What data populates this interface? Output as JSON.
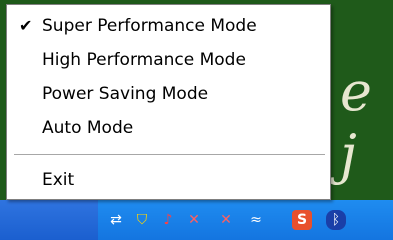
{
  "wallpaper": {
    "text": "e j"
  },
  "menu": {
    "items": [
      {
        "label": "Super Performance Mode",
        "checked": true
      },
      {
        "label": "High Performance Mode",
        "checked": false
      },
      {
        "label": "Power Saving Mode",
        "checked": false
      },
      {
        "label": "Auto Mode",
        "checked": false
      }
    ],
    "exit": {
      "label": "Exit"
    },
    "check_icon": "checkmark-icon"
  },
  "tray": {
    "icons": [
      "network-icon",
      "security-shield-icon",
      "volume-icon",
      "network-disconnected-icon",
      "network-disconnected-icon",
      "wifi-icon",
      "s-app-icon",
      "bluetooth-icon"
    ]
  }
}
